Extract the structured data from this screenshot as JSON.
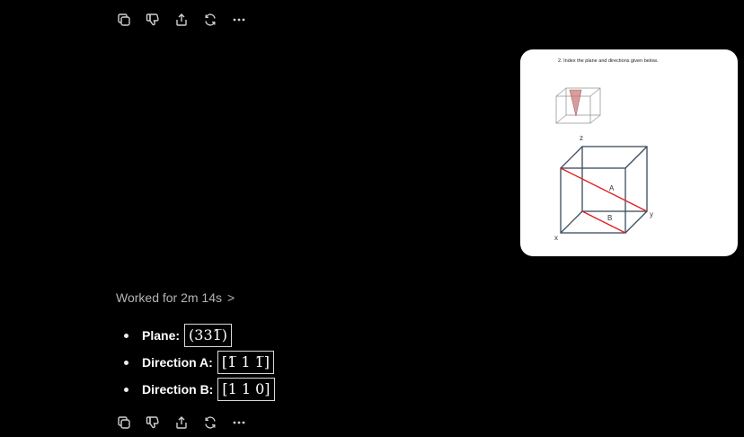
{
  "image": {
    "question": "2.   Index the plane and directions given below.",
    "axis_z": "z",
    "axis_x": "x",
    "axis_y": "y",
    "label_a": "A",
    "label_b": "B"
  },
  "status": {
    "worked": "Worked for 2m 14s",
    "chevron": ">"
  },
  "answers": [
    {
      "label": "Plane:",
      "value": "(331̅)"
    },
    {
      "label": "Direction A:",
      "value": "[1̅ 1 1̅]"
    },
    {
      "label": "Direction B:",
      "value": "[1 1 0]"
    }
  ],
  "icons": [
    "copy-icon",
    "thumbs-down-icon",
    "share-icon",
    "regenerate-icon",
    "more-icon"
  ],
  "colors": {
    "background": "#000000",
    "text": "#ececec",
    "muted": "#b4b4b4",
    "diagram_red": "#e02020"
  }
}
